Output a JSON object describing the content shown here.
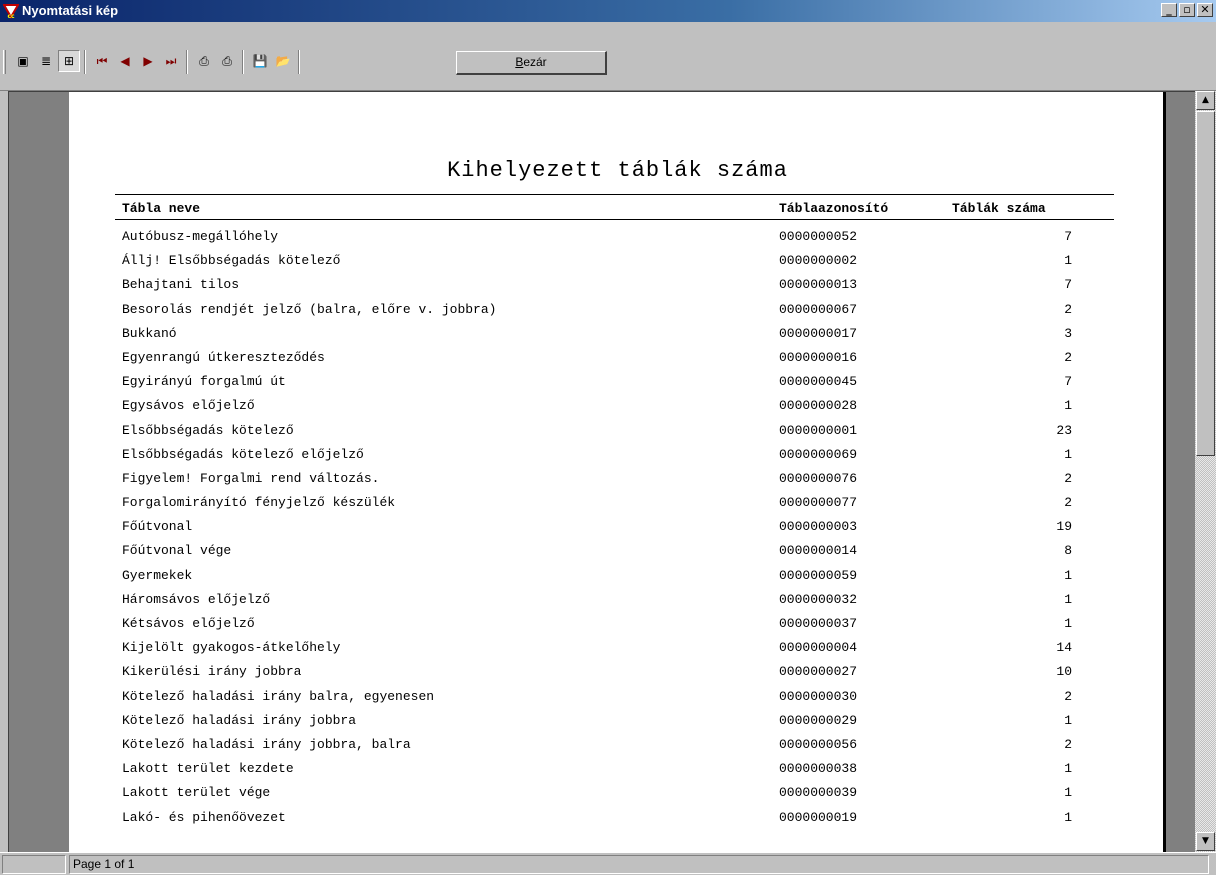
{
  "window": {
    "title": "Nyomtatási kép",
    "minimize_glyph": "_",
    "maximize_glyph": "▫",
    "close_glyph": "✕"
  },
  "toolbar": {
    "buttons": [
      {
        "name": "one-page-view-icon",
        "glyph": "▣"
      },
      {
        "name": "two-page-view-icon",
        "glyph": "≣"
      },
      {
        "name": "zoom-page-icon",
        "glyph": "⊞"
      },
      {
        "name": "first-page-icon",
        "glyph": "⏮"
      },
      {
        "name": "prev-page-icon",
        "glyph": "◀"
      },
      {
        "name": "next-page-icon",
        "glyph": "▶"
      },
      {
        "name": "last-page-icon",
        "glyph": "⏭"
      },
      {
        "name": "print-setup-icon",
        "glyph": "⎙"
      },
      {
        "name": "print-icon",
        "glyph": "⎙"
      },
      {
        "name": "save-icon",
        "glyph": "💾"
      },
      {
        "name": "open-icon",
        "glyph": "📂"
      }
    ],
    "close_accel": "B",
    "close_rest": "ezár"
  },
  "report": {
    "title": "Kihelyezett táblák száma",
    "columns": [
      "Tábla neve",
      "Táblaazonosító",
      "Táblák száma"
    ],
    "rows": [
      [
        "Autóbusz-megállóhely",
        "0000000052",
        "7"
      ],
      [
        "Állj! Elsőbbségadás kötelező",
        "0000000002",
        "1"
      ],
      [
        "Behajtani tilos",
        "0000000013",
        "7"
      ],
      [
        "Besorolás rendjét jelző (balra, előre v. jobbra)",
        "0000000067",
        "2"
      ],
      [
        "Bukkanó",
        "0000000017",
        "3"
      ],
      [
        "Egyenrangú útkereszteződés",
        "0000000016",
        "2"
      ],
      [
        "Egyirányú forgalmú út",
        "0000000045",
        "7"
      ],
      [
        "Egysávos előjelző",
        "0000000028",
        "1"
      ],
      [
        "Elsőbbségadás kötelező",
        "0000000001",
        "23"
      ],
      [
        "Elsőbbségadás kötelező előjelző",
        "0000000069",
        "1"
      ],
      [
        "Figyelem! Forgalmi rend változás.",
        "0000000076",
        "2"
      ],
      [
        "Forgalomirányító fényjelző készülék",
        "0000000077",
        "2"
      ],
      [
        "Főútvonal",
        "0000000003",
        "19"
      ],
      [
        "Főútvonal vége",
        "0000000014",
        "8"
      ],
      [
        "Gyermekek",
        "0000000059",
        "1"
      ],
      [
        "Háromsávos előjelző",
        "0000000032",
        "1"
      ],
      [
        "Kétsávos előjelző",
        "0000000037",
        "1"
      ],
      [
        "Kijelölt gyakogos-átkelőhely",
        "0000000004",
        "14"
      ],
      [
        "Kikerülési irány jobbra",
        "0000000027",
        "10"
      ],
      [
        "Kötelező haladási irány balra, egyenesen",
        "0000000030",
        "2"
      ],
      [
        "Kötelező haladási irány jobbra",
        "0000000029",
        "1"
      ],
      [
        "Kötelező haladási irány jobbra, balra",
        "0000000056",
        "2"
      ],
      [
        "Lakott terület kezdete",
        "0000000038",
        "1"
      ],
      [
        "Lakott terület vége",
        "0000000039",
        "1"
      ],
      [
        "Lakó- és pihenőövezet",
        "0000000019",
        "1"
      ]
    ]
  },
  "scrollbar": {
    "up_glyph": "▲",
    "down_glyph": "▼"
  },
  "status": {
    "page_text": "Page 1 of 1"
  }
}
